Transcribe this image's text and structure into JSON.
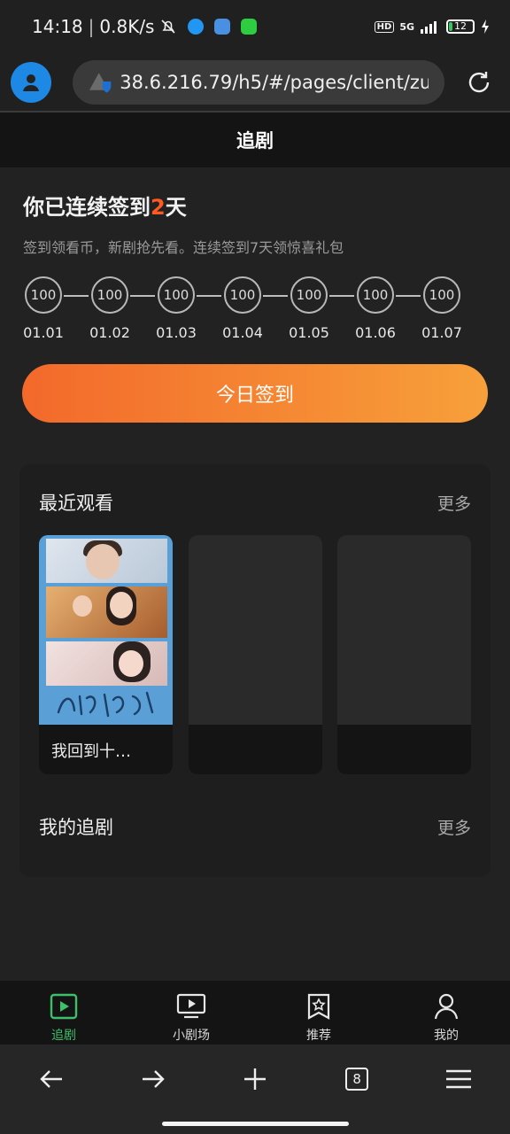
{
  "status_bar": {
    "time": "14:18",
    "speed": "0.8K/s",
    "network": "5G",
    "hd": "HD",
    "battery": "12"
  },
  "browser": {
    "url": "38.6.216.79/h5/#/pages/client/zui"
  },
  "header": {
    "title": "追剧"
  },
  "signin": {
    "title_prefix": "你已连续签到",
    "days_count": "2",
    "title_suffix": "天",
    "subtitle": "签到领看币，新剧抢先看。连续签到7天领惊喜礼包",
    "days": [
      {
        "coin": "100",
        "date": "01.01"
      },
      {
        "coin": "100",
        "date": "01.02"
      },
      {
        "coin": "100",
        "date": "01.03"
      },
      {
        "coin": "100",
        "date": "01.04"
      },
      {
        "coin": "100",
        "date": "01.05"
      },
      {
        "coin": "100",
        "date": "01.06"
      },
      {
        "coin": "100",
        "date": "01.07"
      }
    ],
    "button_label": "今日签到"
  },
  "recent": {
    "title": "最近观看",
    "more": "更多",
    "items": [
      {
        "name": "我回到十…"
      }
    ]
  },
  "following": {
    "title": "我的追剧",
    "more": "更多"
  },
  "tabs": [
    {
      "label": "追剧",
      "icon": "play-square-icon",
      "active": true
    },
    {
      "label": "小剧场",
      "icon": "tv-play-icon",
      "active": false
    },
    {
      "label": "推荐",
      "icon": "bookmark-star-icon",
      "active": false
    },
    {
      "label": "我的",
      "icon": "user-icon",
      "active": false
    }
  ],
  "browser_nav": {
    "tab_count": "8"
  },
  "colors": {
    "accent_green": "#3fbf6a",
    "accent_orange": "#ff5a1f",
    "button_gradient_start": "#f3692b",
    "button_gradient_end": "#f7a03a"
  }
}
